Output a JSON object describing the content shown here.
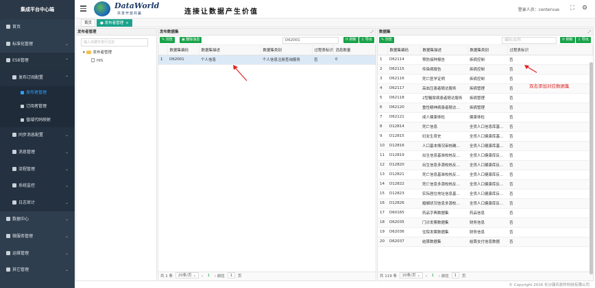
{
  "sidebar": {
    "title": "集成平台中心端",
    "items": [
      {
        "label": "首页",
        "icon": "home-icon"
      },
      {
        "label": "标准化管理",
        "icon": "document-icon"
      },
      {
        "label": "ESB管理",
        "icon": "bus-icon"
      },
      {
        "label": "发布订阅配置",
        "icon": "gear-icon"
      },
      {
        "label": "发布者管理",
        "icon": "wrench-icon"
      },
      {
        "label": "订阅者管理",
        "icon": "wrench-icon"
      },
      {
        "label": "值域代码映射",
        "icon": "wrench-icon"
      },
      {
        "label": "同步消息配置",
        "icon": "gear-icon"
      },
      {
        "label": "消息管理",
        "icon": "gear-icon"
      },
      {
        "label": "流程管理",
        "icon": "gear-icon"
      },
      {
        "label": "系统监控",
        "icon": "gear-icon"
      },
      {
        "label": "日志审计",
        "icon": "gear-icon"
      },
      {
        "label": "数据中心",
        "icon": "database-icon"
      },
      {
        "label": "微服务管理",
        "icon": "service-icon"
      },
      {
        "label": "运维管理",
        "icon": "monitor-icon"
      },
      {
        "label": "其它管理",
        "icon": "grid-icon"
      }
    ]
  },
  "header": {
    "brand": "DataWorld",
    "brand_sub": "共享开放共赢",
    "slogan": "连接让数据产生价值",
    "user_label": "登录人员：centervue"
  },
  "tabs": [
    {
      "label": "首页"
    },
    {
      "label": "发布者管理"
    }
  ],
  "publisher_panel": {
    "title": "发布者管理",
    "search_placeholder": "输入关键字进行过滤",
    "tree_root": "发布者管理",
    "tree_child": "HIS"
  },
  "dataset_panel": {
    "title": "发布数据集",
    "btn_browse": "浏览",
    "btn_delete": "删除消息",
    "search_value": "D62001",
    "btn_refresh": "刷新",
    "btn_export": "导出",
    "columns": [
      "",
      "数据集编码",
      "数据集描述",
      "数据集类别",
      "过程表标识",
      "消息数量"
    ],
    "rows": [
      [
        "1",
        "D62001",
        "个人信息",
        "个人信息注册查询服务",
        "否",
        "0"
      ]
    ],
    "pager": {
      "total": "共 1 条",
      "per_page": "20条/页",
      "goto": "前往",
      "page": "1",
      "page_unit": "页"
    }
  },
  "all_panel": {
    "title": "数据集",
    "btn_browse": "浏览",
    "search_placeholder": "编码/名称",
    "btn_refresh": "刷新",
    "btn_export": "导出",
    "columns": [
      "",
      "数据集编码",
      "数据集描述",
      "数据集类别",
      "过程表标识"
    ],
    "rows": [
      [
        "1",
        "D62114",
        "预防接种报告",
        "疾病控制",
        "否"
      ],
      [
        "2",
        "D62115",
        "传染病报告",
        "疾病控制",
        "否"
      ],
      [
        "3",
        "D62116",
        "死亡医学证明",
        "疾病控制",
        "否"
      ],
      [
        "4",
        "D62117",
        "高血压患者随访服务",
        "疾病管理",
        "否"
      ],
      [
        "5",
        "D62118",
        "2型糖尿病患者随访服务",
        "疾病管理",
        "否"
      ],
      [
        "6",
        "D62120",
        "重性精神病患者随访...",
        "疾病管理",
        "否"
      ],
      [
        "7",
        "D62121",
        "成人健康体检",
        "健康体检",
        "否"
      ],
      [
        "8",
        "D12814",
        "死亡信息",
        "全员人口信息库基...",
        "否"
      ],
      [
        "9",
        "D12815",
        "妇女生育史",
        "全员人口健康库基...",
        "否"
      ],
      [
        "10",
        "D12816",
        "人口基本情况审核确...",
        "全员人口健康库基...",
        "否"
      ],
      [
        "11",
        "D12819",
        "出生信息基准校核反...",
        "全员人口健康库反...",
        "否"
      ],
      [
        "12",
        "D12820",
        "出生信息多源校核反...",
        "全员人口健康库反...",
        "否"
      ],
      [
        "13",
        "D12821",
        "死亡信息基准校核反...",
        "全员人口健康库反...",
        "否"
      ],
      [
        "14",
        "D12822",
        "死亡信息多源校核反...",
        "全员人口健康库反...",
        "否"
      ],
      [
        "15",
        "D12823",
        "实际居住地址信息基...",
        "全员人口健康库反...",
        "否"
      ],
      [
        "16",
        "D12826",
        "婚姻状况信息多源校...",
        "全员人口健康库反...",
        "否"
      ],
      [
        "17",
        "D60165",
        "药品字典数据集",
        "药品信息",
        "否"
      ],
      [
        "18",
        "D62035",
        "门诊发票数据集",
        "财务信息",
        "否"
      ],
      [
        "19",
        "D62036",
        "住院发票数据集",
        "财务信息",
        "否"
      ],
      [
        "20",
        "D62037",
        "结算数据集",
        "结算支付信息数据",
        "否"
      ]
    ],
    "pager": {
      "total": "共 119 条",
      "per_page": "20条/页",
      "goto": "前往",
      "page": "1",
      "page_unit": "页"
    }
  },
  "annotation": "双击添加对应数据集",
  "copyright": "© Copyright 2016 长沙康氏软件科技有限公司",
  "colors": {
    "sidebar_bg": "#2f3e4e",
    "accent_green": "#1aa34a",
    "tab_active": "#1aa38c",
    "highlight": "#2e9fff",
    "annotation": "#e02020"
  }
}
